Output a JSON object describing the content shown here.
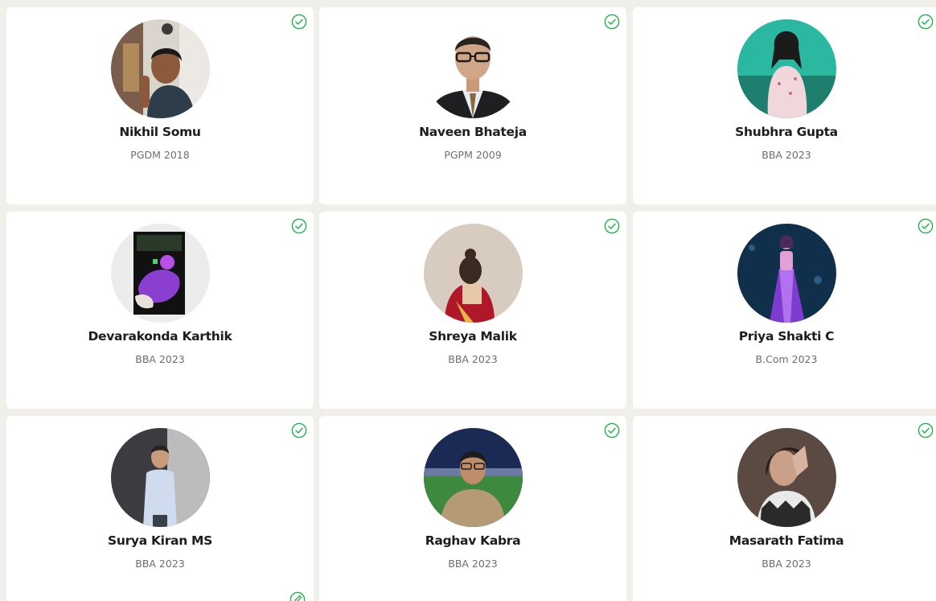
{
  "colors": {
    "background": "#f0efea",
    "card": "#ffffff",
    "name": "#1d1d1d",
    "batch": "#6d6d6d",
    "verified": "#22b24c"
  },
  "profiles": [
    {
      "name": "Nikhil Somu",
      "batch": "PGDM 2018",
      "verified_icon": "check-circle-icon"
    },
    {
      "name": "Naveen Bhateja",
      "batch": "PGPM 2009",
      "verified_icon": "check-circle-icon"
    },
    {
      "name": "Shubhra Gupta",
      "batch": "BBA 2023",
      "verified_icon": "check-circle-icon"
    },
    {
      "name": "Devarakonda Karthik",
      "batch": "BBA 2023",
      "verified_icon": "check-circle-icon"
    },
    {
      "name": "Shreya Malik",
      "batch": "BBA 2023",
      "verified_icon": "check-circle-icon"
    },
    {
      "name": "Priya Shakti C",
      "batch": "B.Com 2023",
      "verified_icon": "check-circle-icon"
    },
    {
      "name": "Surya Kiran MS",
      "batch": "BBA 2023",
      "verified_icon": "check-circle-icon"
    },
    {
      "name": "Raghav Kabra",
      "batch": "BBA 2023",
      "verified_icon": "check-circle-icon"
    },
    {
      "name": "Masarath Fatima",
      "batch": "BBA 2023",
      "verified_icon": "check-circle-icon"
    }
  ]
}
